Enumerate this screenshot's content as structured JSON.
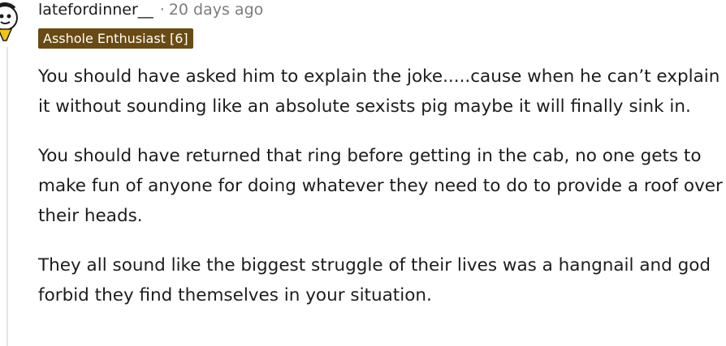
{
  "comment": {
    "author": "latefordinner__",
    "separator": "·",
    "timestamp": "20 days ago",
    "flair": "Asshole Enthusiast [6]",
    "paragraphs": [
      "You should have asked him to explain the joke.....cause when he can’t explain it without sounding like an absolute sexists pig maybe it will finally sink in.",
      "You should have returned that ring before getting in the cab, no one gets to make fun of anyone for doing whatever they need to do to provide a roof over their heads.",
      "They all sound like the biggest struggle of their lives was a hangnail and god forbid they find themselves in your situation."
    ],
    "colors": {
      "flair_background": "#6a4a13",
      "meta_text": "#7c7c7c",
      "body_text": "#1c1c1c"
    },
    "avatar_icon": "snoo-avatar-icon"
  }
}
